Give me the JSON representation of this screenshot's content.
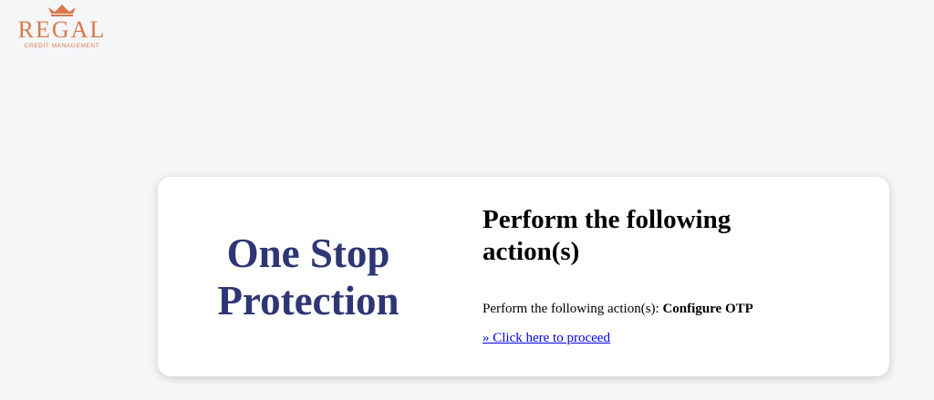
{
  "logo": {
    "brand": "REGAL",
    "tagline": "CREDIT MANAGEMENT",
    "icon": "crown-icon",
    "color": "#d9784a"
  },
  "card": {
    "hero_title": "One Stop Protection",
    "heading": "Perform the following action(s)",
    "action_prefix": "Perform the following action(s): ",
    "action_value": "Configure OTP",
    "link_label": "» Click here to proceed"
  },
  "colors": {
    "background": "#f5f6f8",
    "hero": "#2e3676",
    "link": "#0000ee"
  }
}
